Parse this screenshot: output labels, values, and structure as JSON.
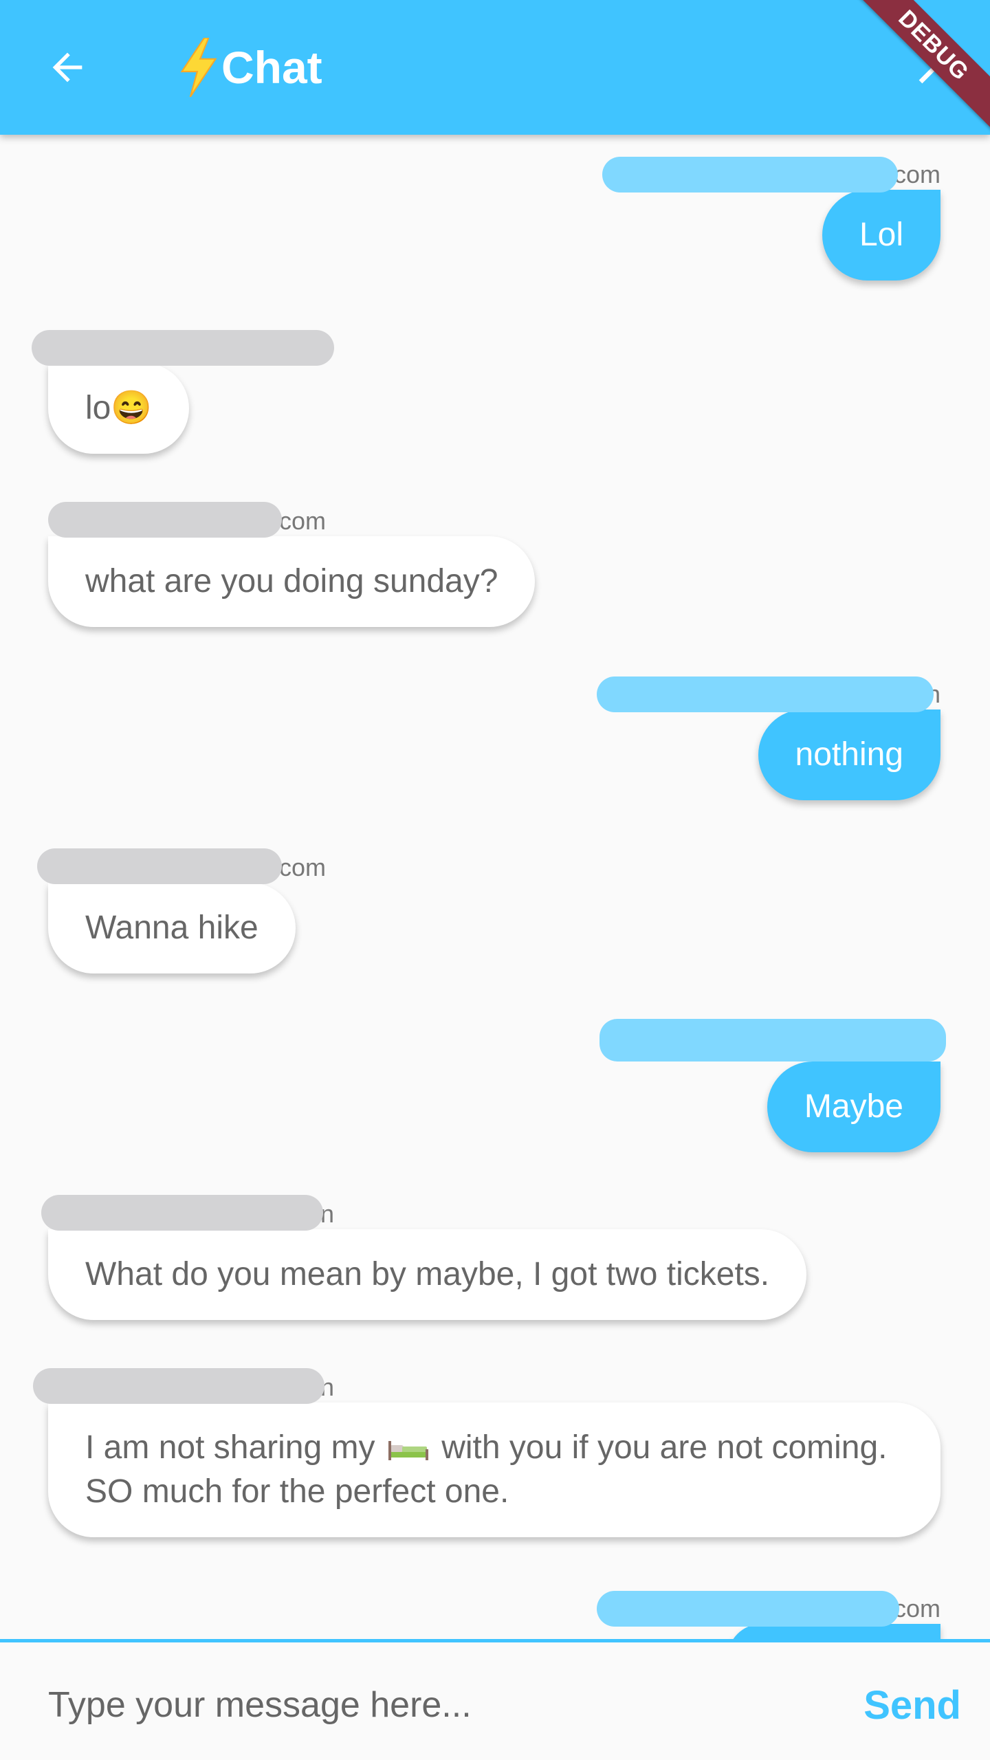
{
  "appbar": {
    "title": "Chat",
    "title_icon": "lightning-bolt-icon",
    "back_icon": "arrow-back-icon",
    "close_icon": "close-icon",
    "debug_label": "DEBUG",
    "color": "#40c4ff"
  },
  "messages": [
    {
      "sender": "com",
      "text": "Lol",
      "from_me": true
    },
    {
      "sender": "",
      "text": "lo😄",
      "from_me": false
    },
    {
      "sender": "com",
      "text": "what are you doing sunday?",
      "from_me": false
    },
    {
      "sender": "n",
      "text": "nothing",
      "from_me": true
    },
    {
      "sender": "com",
      "text": "Wanna hike",
      "from_me": false
    },
    {
      "sender": "",
      "text": "Maybe",
      "from_me": true
    },
    {
      "sender": "n",
      "text": "What do you mean by maybe, I got two tickets.",
      "from_me": false
    },
    {
      "sender": "n",
      "text_before": "I am not sharing my",
      "inline_icon": "bed-icon",
      "text_after": "with you if you are not coming. SO much for the perfect one.",
      "from_me": false
    },
    {
      "sender": "com",
      "text": "",
      "from_me": true
    }
  ],
  "composer": {
    "placeholder": "Type your message here...",
    "send_label": "Send"
  },
  "colors": {
    "accent": "#40c4ff",
    "redact_me": "#80d8ff",
    "redact_them": "#d3d3d5",
    "debug": "#8b2f40"
  }
}
